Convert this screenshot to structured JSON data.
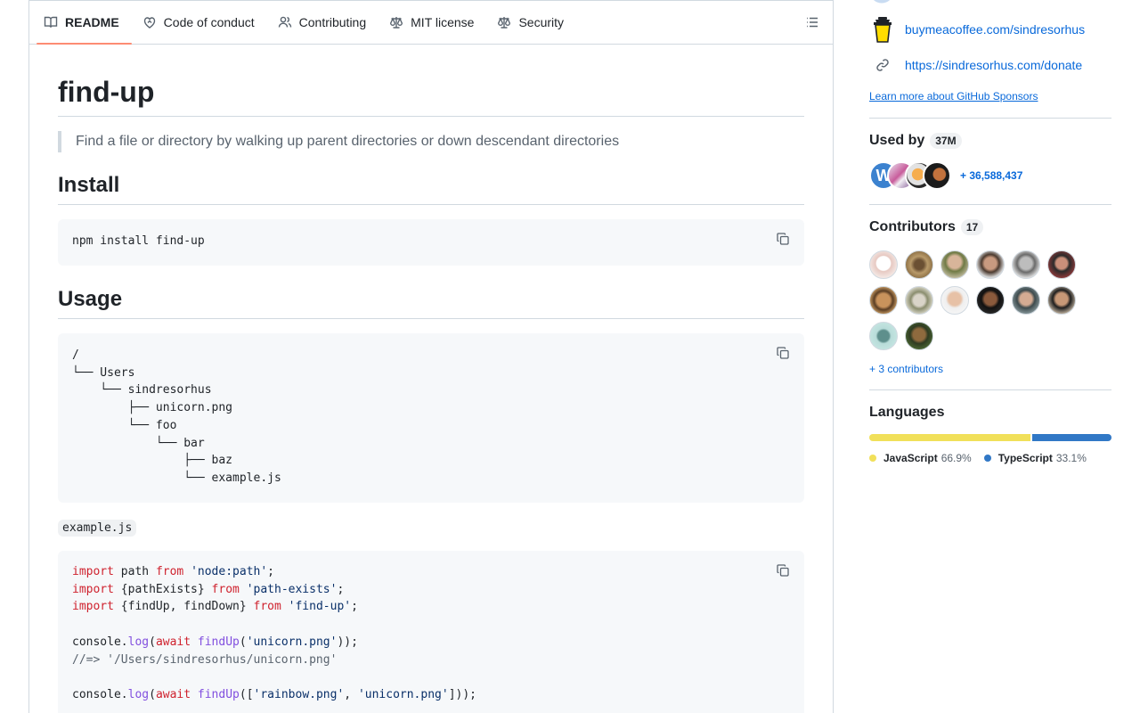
{
  "tabs": [
    {
      "label": "README",
      "icon": "book-icon",
      "active": true
    },
    {
      "label": "Code of conduct",
      "icon": "heart-icon"
    },
    {
      "label": "Contributing",
      "icon": "people-icon"
    },
    {
      "label": "MIT license",
      "icon": "law-icon"
    },
    {
      "label": "Security",
      "icon": "law-icon"
    }
  ],
  "readme": {
    "title": "find-up",
    "description": "Find a file or directory by walking up parent directories or down descendant directories",
    "install_heading": "Install",
    "install_cmd": "npm install find-up",
    "usage_heading": "Usage",
    "tree": [
      "/",
      "└── Users",
      "    └── sindresorhus",
      "        ├── unicorn.png",
      "        └── foo",
      "            └── bar",
      "                ├── baz",
      "                └── example.js"
    ],
    "example_filename": "example.js",
    "code": {
      "l1": {
        "kw1": "import",
        "mid": " path ",
        "kw2": "from",
        "str": "'node:path'",
        "end": ";"
      },
      "l2": {
        "kw1": "import",
        "mid": " {pathExists} ",
        "kw2": "from",
        "str": "'path-exists'",
        "end": ";"
      },
      "l3": {
        "kw1": "import",
        "mid": " {findUp, findDown} ",
        "kw2": "from",
        "str": "'find-up'",
        "end": ";"
      },
      "l5": {
        "pre": "console.",
        "fn1": "log",
        "p1": "(",
        "kw": "await",
        "sp": " ",
        "fn2": "findUp",
        "p2": "(",
        "str": "'unicorn.png'",
        "end": "));"
      },
      "l6": {
        "comment": "//=> '/Users/sindresorhus/unicorn.png'"
      },
      "l8": {
        "pre": "console.",
        "fn1": "log",
        "p1": "(",
        "kw": "await",
        "sp": " ",
        "fn2": "findUp",
        "p2": "([",
        "str1": "'rainbow.png'",
        "comma": ", ",
        "str2": "'unicorn.png'",
        "end": "]));"
      }
    }
  },
  "sidebar": {
    "sponsors": [
      {
        "icon": "coffee-cup-icon",
        "label": "buymeacoffee.com/sindresorhus"
      },
      {
        "icon": "link-icon",
        "label": "https://sindresorhus.com/donate"
      }
    ],
    "learn_more": "Learn more about GitHub Sponsors",
    "used_by": {
      "title": "Used by",
      "count": "37M",
      "more": "+ 36,588,437"
    },
    "contributors": {
      "title": "Contributors",
      "count": "17",
      "more": "+ 3 contributors"
    },
    "languages": {
      "title": "Languages",
      "items": [
        {
          "name": "JavaScript",
          "pct": "66.9%",
          "value": 66.9,
          "color": "#f1e05a"
        },
        {
          "name": "TypeScript",
          "pct": "33.1%",
          "value": 33.1,
          "color": "#3178c6"
        }
      ]
    }
  }
}
